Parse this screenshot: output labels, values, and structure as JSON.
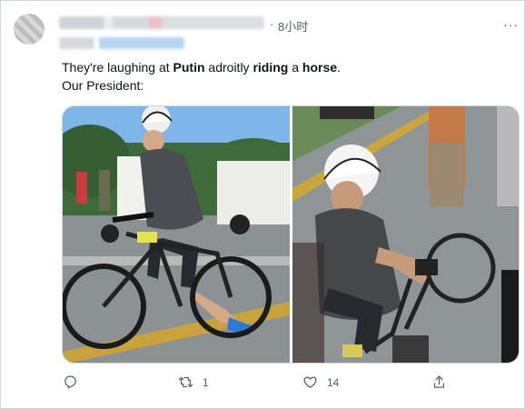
{
  "tweet": {
    "time": "8小时",
    "separator": "·",
    "more_label": "···",
    "text": {
      "line1": [
        {
          "t": "They're laughing at ",
          "b": false
        },
        {
          "t": "Putin",
          "b": true
        },
        {
          "t": " adroitly ",
          "b": false
        },
        {
          "t": "riding",
          "b": true
        },
        {
          "t": " a ",
          "b": false
        },
        {
          "t": "horse",
          "b": true
        },
        {
          "t": ".",
          "b": false
        }
      ],
      "line2": "Our President:"
    },
    "actions": {
      "reply_count": "",
      "retweet_count": "1",
      "like_count": "14",
      "share_count": ""
    }
  },
  "colors": {
    "text": "#0f1419",
    "muted": "#536471",
    "border": "#cfd9de",
    "sky": "#7fb6ea",
    "road": "#8f9497"
  }
}
